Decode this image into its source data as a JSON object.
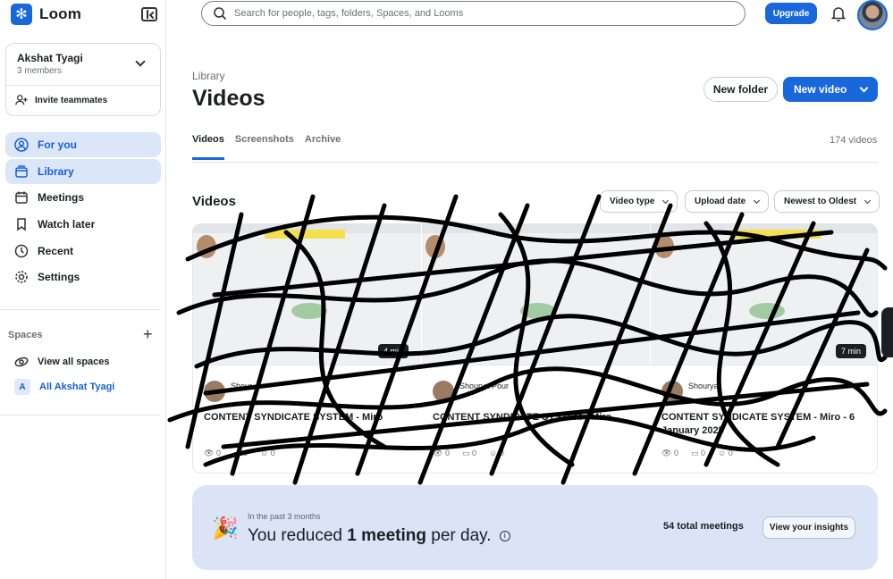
{
  "brand": {
    "name": "Loom",
    "logo_icon": "loom-logo-icon"
  },
  "workspace": {
    "name": "Akshat Tyagi",
    "members": "3 members",
    "invite_label": "Invite teammates"
  },
  "nav": {
    "items": [
      {
        "label": "For you",
        "icon": "user-circle-icon",
        "active": true
      },
      {
        "label": "Library",
        "icon": "library-icon",
        "active": true
      },
      {
        "label": "Meetings",
        "icon": "calendar-icon",
        "active": false
      },
      {
        "label": "Watch later",
        "icon": "bookmark-icon",
        "active": false
      },
      {
        "label": "Recent",
        "icon": "clock-icon",
        "active": false
      },
      {
        "label": "Settings",
        "icon": "gear-icon",
        "active": false
      }
    ]
  },
  "spaces": {
    "title": "Spaces",
    "view_all": "View all spaces",
    "all_space": {
      "badge": "A",
      "label": "All Akshat Tyagi"
    }
  },
  "topbar": {
    "search_placeholder": "Search for people, tags, folders, Spaces, and Looms",
    "upgrade_label": "Upgrade"
  },
  "header": {
    "breadcrumb": "Library",
    "title": "Videos",
    "new_folder_label": "New folder",
    "new_video_label": "New video"
  },
  "tabs": {
    "items": [
      "Videos",
      "Screenshots",
      "Archive"
    ],
    "count": "174 videos"
  },
  "videos": {
    "section_title": "Videos",
    "filters": [
      "Video type",
      "Upload date",
      "Newest to Oldest"
    ],
    "cards": [
      {
        "owner": "Shour",
        "title": "CONTENT SYNDICATE SYSTEM - Miro",
        "duration": "4 min",
        "views": "0",
        "comments": "0",
        "reactions": "0"
      },
      {
        "owner": "Shourya Pour",
        "title": "CONTENT SYNDICATE SYSTEM - Miro",
        "duration": "",
        "views": "0",
        "comments": "0",
        "reactions": "0"
      },
      {
        "owner": "Shourya",
        "title": "CONTENT SYNDICATE SYSTEM - Miro - 6 January 2025",
        "duration": "7 min",
        "views": "0",
        "comments": "0",
        "reactions": "0"
      }
    ]
  },
  "insights": {
    "subtitle": "In the past 3 months",
    "text_pre": "You reduced ",
    "text_bold": "1 meeting",
    "text_post": " per day.",
    "total": "54 total meetings",
    "button_label": "View your insights"
  },
  "colors": {
    "accent": "#1868db",
    "active_bg": "#dce6f9",
    "insights_bg": "#dbe4f7"
  }
}
